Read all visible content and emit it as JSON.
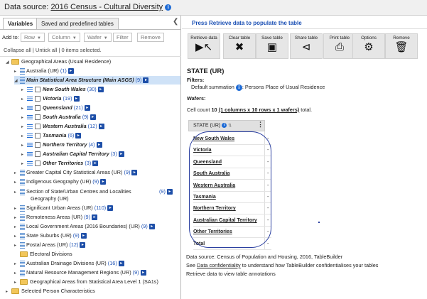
{
  "header": {
    "prefix": "Data source:",
    "source": "2016 Census - Cultural Diversity"
  },
  "tabs": [
    {
      "label": "Variables"
    },
    {
      "label": "Saved and predefined tables"
    }
  ],
  "addto": {
    "label": "Add to:",
    "row": "Row",
    "column": "Column",
    "wafer": "Wafer",
    "filter": "Filter",
    "remove": "Remove"
  },
  "collapse": {
    "collapse_all": "Collapse all",
    "untick_all": "Untick all",
    "selected": "0 items selected."
  },
  "tree": [
    {
      "label": "Geographical Areas (Usual Residence)",
      "count": ""
    },
    {
      "label": "Australia (UR)",
      "count": "(1)"
    },
    {
      "label": "Main Statistical Area Structure (Main ASGS)",
      "count": "(9)"
    },
    {
      "label": "New South Wales",
      "count": "(30)"
    },
    {
      "label": "Victoria",
      "count": "(19)"
    },
    {
      "label": "Queensland",
      "count": "(21)"
    },
    {
      "label": "South Australia",
      "count": "(9)"
    },
    {
      "label": "Western Australia",
      "count": "(12)"
    },
    {
      "label": "Tasmania",
      "count": "(6)"
    },
    {
      "label": "Northern Territory",
      "count": "(4)"
    },
    {
      "label": "Australian Capital Territory",
      "count": "(3)"
    },
    {
      "label": "Other Territories",
      "count": "(3)"
    },
    {
      "label": "Greater Capital City Statistical Areas (UR)",
      "count": "(9)"
    },
    {
      "label": "Indigenous Geography (UR)",
      "count": "(9)"
    },
    {
      "label": "Section of State/Urban Centres and Localities",
      "count": "(9)"
    },
    {
      "label": "Geography (UR)",
      "count": ""
    },
    {
      "label": "Significant Urban Areas (UR)",
      "count": "(110)"
    },
    {
      "label": "Remoteness Areas (UR)",
      "count": "(9)"
    },
    {
      "label": "Local Government Areas (2016 Boundaries) (UR)",
      "count": "(9)"
    },
    {
      "label": "State Suburbs (UR)",
      "count": "(9)"
    },
    {
      "label": "Postal Areas (UR)",
      "count": "(12)"
    },
    {
      "label": "Electoral Divisions",
      "count": ""
    },
    {
      "label": "Australian Drainage Divisions (UR)",
      "count": "(16)"
    },
    {
      "label": "Natural Resource Management Regions (UR)",
      "count": "(9)"
    },
    {
      "label": "Geographical Areas from Statistical Area Level 1 (SA1s)",
      "count": ""
    },
    {
      "label": "Selected Person Characteristics",
      "count": ""
    }
  ],
  "right": {
    "banner": "Press Retrieve data to populate the table",
    "toolbar": [
      {
        "label": "Retrieve data",
        "icon": "play-cursor-icon"
      },
      {
        "label": "Clear table",
        "icon": "x-icon"
      },
      {
        "label": "Save table",
        "icon": "save-icon"
      },
      {
        "label": "Share table",
        "icon": "share-icon"
      },
      {
        "label": "Print table",
        "icon": "print-icon"
      },
      {
        "label": "Options",
        "icon": "gears-icon"
      },
      {
        "label": "Remove",
        "icon": "trash-icon"
      }
    ],
    "table_title": "STATE (UR)",
    "filters_label": "Filters:",
    "filter_text_a": "Default summation",
    "filter_text_b": ": Persons Place of Usual Residence",
    "wafers_label": "Wafers:",
    "cellcount_a": "Cell count",
    "cellcount_num": "10",
    "cellcount_link": "(1 columns x 10 rows x 1 wafers)",
    "cellcount_b": "total.",
    "col_header": "STATE (UR)",
    "rows": [
      {
        "label": "New South Wales",
        "value": "-"
      },
      {
        "label": "Victoria",
        "value": "-"
      },
      {
        "label": "Queensland",
        "value": "-"
      },
      {
        "label": "South Australia",
        "value": "-"
      },
      {
        "label": "Western Australia",
        "value": "-"
      },
      {
        "label": "Tasmania",
        "value": "-"
      },
      {
        "label": "Northern Territory",
        "value": "-"
      },
      {
        "label": "Australian Capital Territory",
        "value": "-"
      },
      {
        "label": "Other Territories",
        "value": "-"
      },
      {
        "label": "Total",
        "value": "-"
      }
    ],
    "footer1": "Data source: Census of Population and Housing, 2016, TableBuilder",
    "footer2a": "See",
    "footer2link": "Data confidentiality",
    "footer2b": "to understand how TableBuilder confidentialises your tables",
    "footer3": "Retrieve data to view table annotations"
  }
}
